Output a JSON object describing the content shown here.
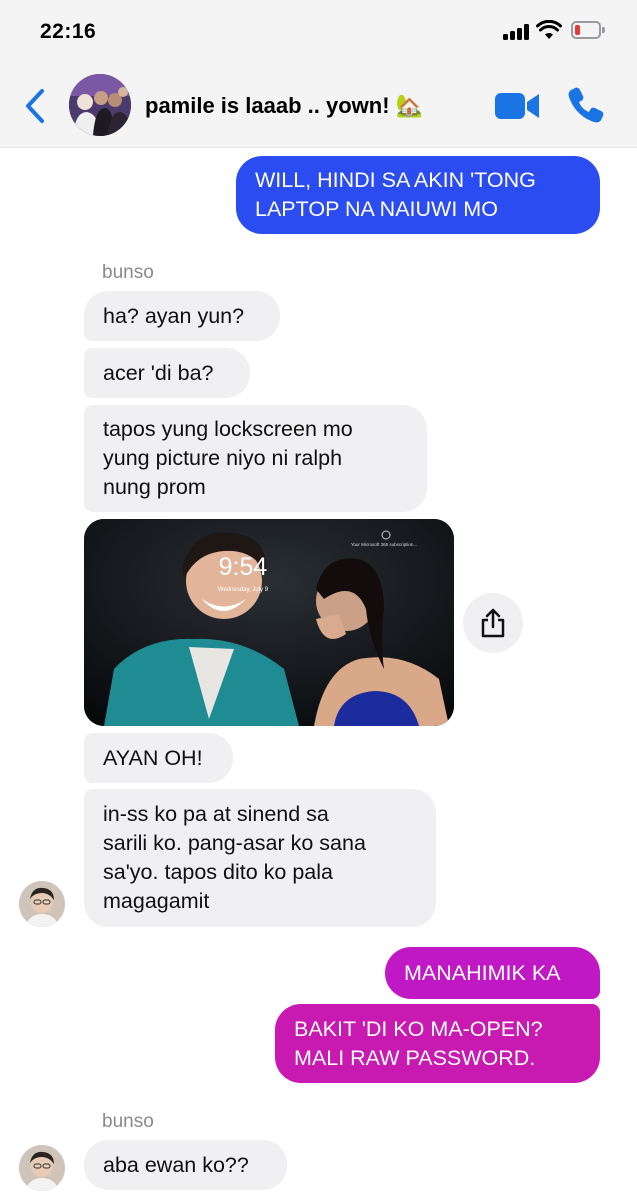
{
  "status_bar": {
    "time": "22:16",
    "signal_icon": "cellular-signal-icon",
    "wifi_icon": "wifi-icon",
    "battery_icon": "battery-low-icon",
    "battery_color": "#e5383b"
  },
  "header": {
    "back_icon": "chevron-left-icon",
    "title": "pamile is laaab .. yown!",
    "title_emoji": "🏡",
    "video_icon": "video-camera-icon",
    "call_icon": "phone-icon",
    "accent_color": "#1b74e4"
  },
  "messages": [
    {
      "lines": [
        "WILL, HINDI SA AKIN 'TONG",
        "LAPTOP NA NAIUWI MO"
      ],
      "color": "#2b4cf0"
    },
    {
      "sender": "bunso"
    },
    {
      "lines": [
        "ha? ayan yun?"
      ]
    },
    {
      "lines": [
        "acer 'di ba?"
      ]
    },
    {
      "lines": [
        "tapos yung lockscreen mo",
        "yung picture niyo ni ralph",
        "nung prom"
      ]
    },
    {
      "photo": {
        "clock": "9:54",
        "date": "Wednesday, July 9",
        "hint": "Your Microsoft 365 subscription..."
      },
      "share_icon": "share-icon"
    },
    {
      "lines": [
        "AYAN OH!"
      ]
    },
    {
      "lines": [
        "in-ss ko pa at sinend sa",
        "sarili ko. pang-asar ko sana",
        "sa'yo. tapos dito ko pala",
        "magagamit"
      ]
    },
    {
      "lines": [
        "MANAHIMIK KA"
      ],
      "color": "#c018c4"
    },
    {
      "lines": [
        "BAKIT 'DI KO MA-OPEN?",
        "MALI RAW PASSWORD."
      ],
      "color": "#c81ab0"
    },
    {
      "sender": "bunso"
    },
    {
      "lines": [
        "aba ewan ko??"
      ]
    }
  ]
}
